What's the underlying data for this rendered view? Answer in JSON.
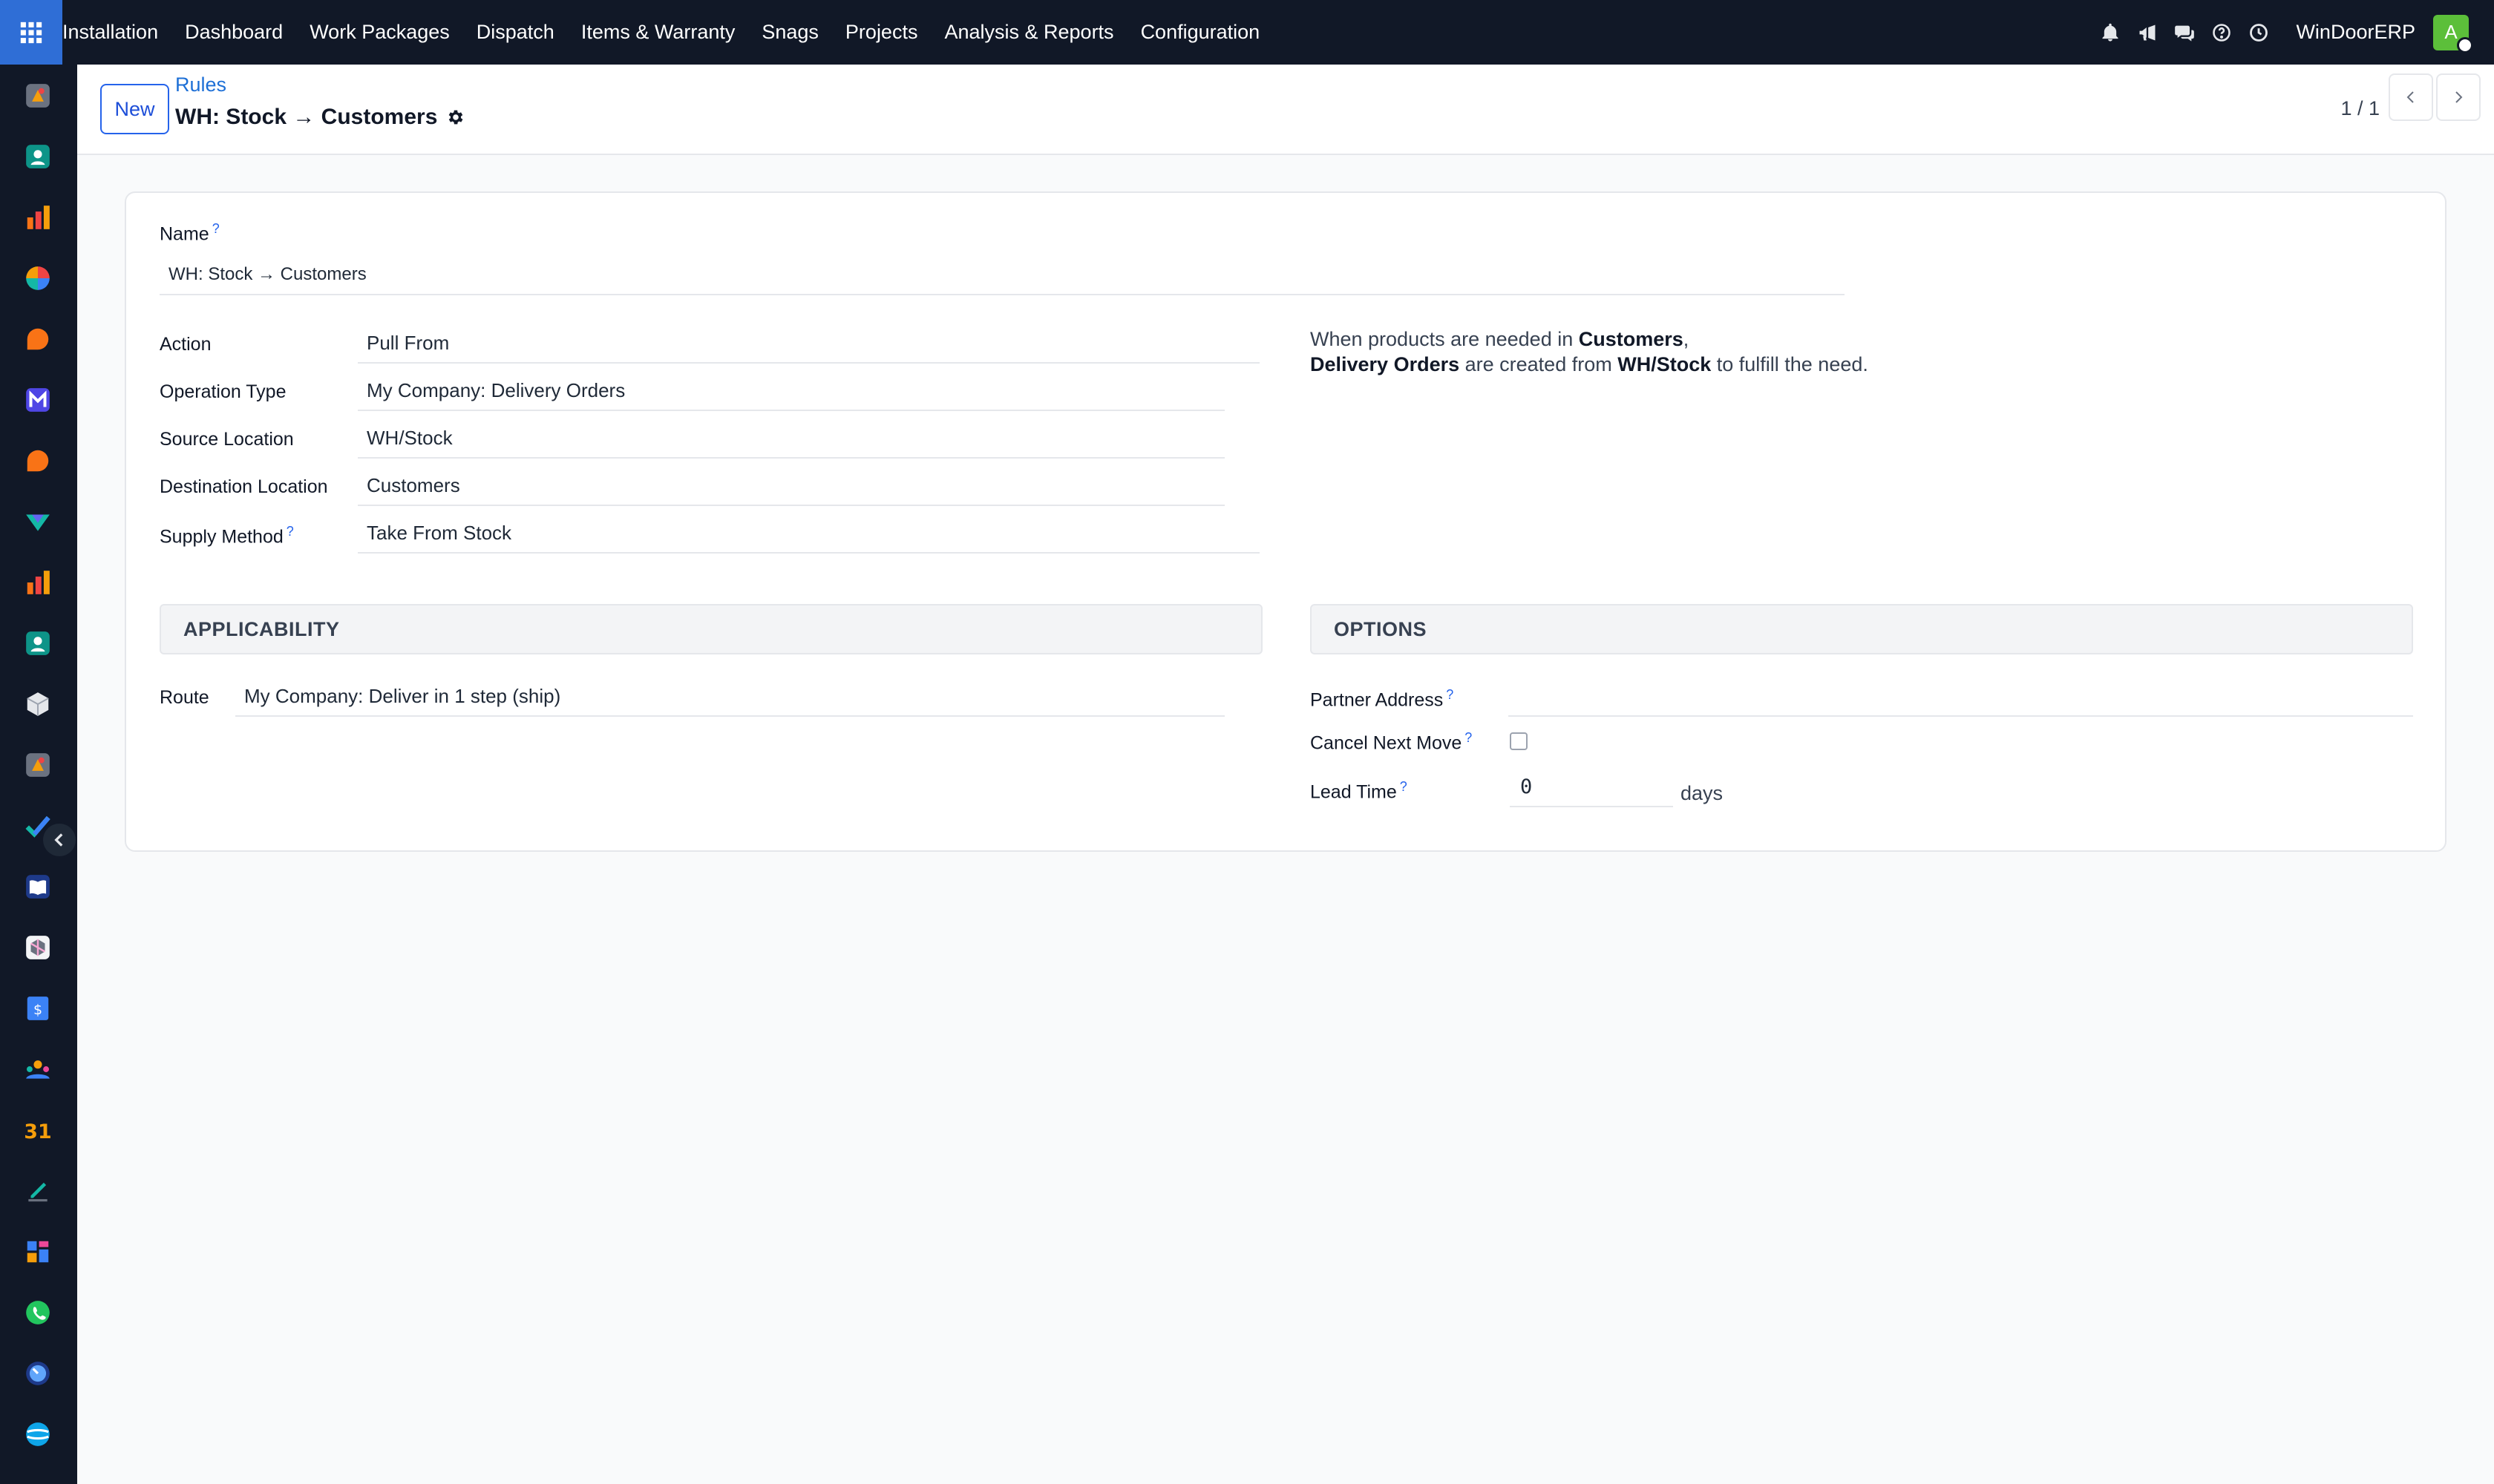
{
  "topbar": {
    "menu": [
      "Installation",
      "Dashboard",
      "Work Packages",
      "Dispatch",
      "Items & Warranty",
      "Snags",
      "Projects",
      "Analysis & Reports",
      "Configuration"
    ],
    "company": "WinDoorERP",
    "avatar_letter": "A",
    "icons": [
      "bell-icon",
      "megaphone-icon",
      "chat-icon",
      "help-icon",
      "clock-icon"
    ]
  },
  "sidebar": {
    "apps": [
      "installation-app-icon",
      "contacts-app-icon",
      "reports-app-icon",
      "dashboard-app-icon",
      "discuss-app-icon",
      "mail-app-icon",
      "livechat-app-icon",
      "helpdesk-app-icon",
      "analytics-app-icon",
      "employees-app-icon",
      "inventory-app-icon",
      "field-service-app-icon",
      "project-app-icon",
      "knowledge-app-icon",
      "product-app-icon",
      "invoicing-app-icon",
      "team-app-icon",
      "calendar-app-icon",
      "sign-app-icon",
      "spreadsheet-app-icon",
      "whatsapp-app-icon",
      "time-off-app-icon",
      "website-app-icon"
    ]
  },
  "control": {
    "new_label": "New",
    "breadcrumb": "Rules",
    "title": "WH: Stock → Customers",
    "pager": "1 / 1"
  },
  "form": {
    "name_label": "Name",
    "name_value": "WH: Stock → Customers",
    "action_label": "Action",
    "action_value": "Pull From",
    "operation_type_label": "Operation Type",
    "operation_type_value": "My Company: Delivery Orders",
    "source_label": "Source Location",
    "source_value": "WH/Stock",
    "destination_label": "Destination Location",
    "destination_value": "Customers",
    "supply_label": "Supply Method",
    "supply_value": "Take From Stock",
    "hint": {
      "p1": "When products are needed in ",
      "b1": "Customers",
      "p2": ",",
      "b2": "Delivery Orders",
      "p3": " are created from ",
      "b3": "WH/Stock",
      "p4": " to fulfill the need."
    },
    "applicability_title": "APPLICABILITY",
    "options_title": "OPTIONS",
    "route_label": "Route",
    "route_value": "My Company: Deliver in 1 step (ship)",
    "partner_label": "Partner Address",
    "partner_value": "",
    "cancel_label": "Cancel Next Move",
    "cancel_checked": false,
    "lead_label": "Lead Time",
    "lead_value": "0",
    "lead_unit": "days",
    "help_mark": "?"
  }
}
